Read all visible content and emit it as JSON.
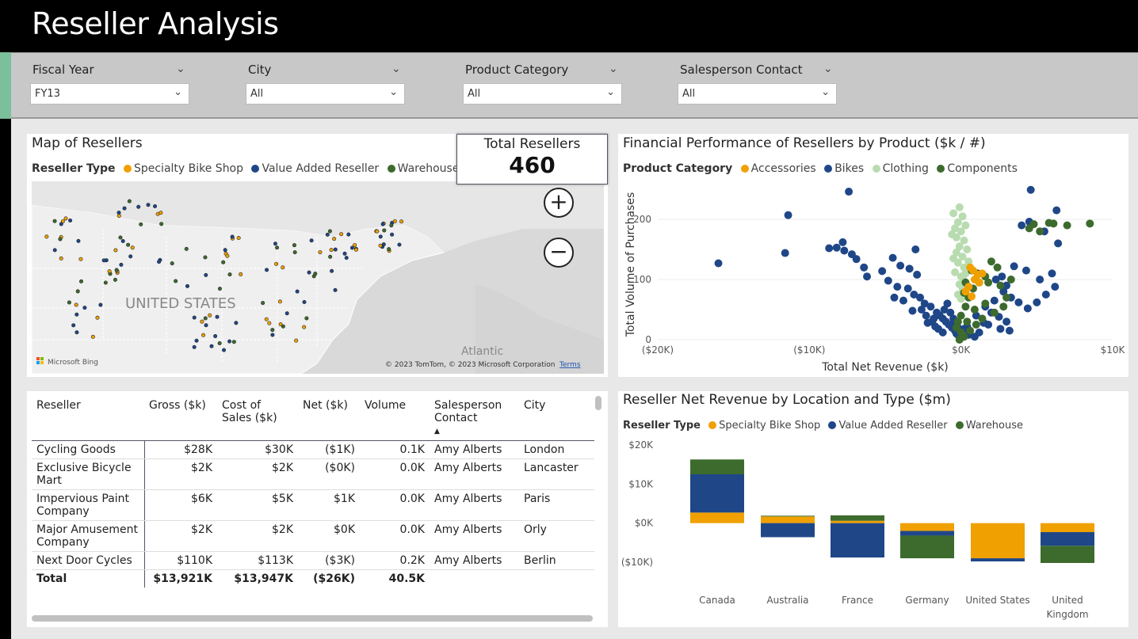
{
  "header": {
    "title": "Reseller Analysis"
  },
  "filters": [
    {
      "label": "Fiscal Year",
      "value": "FY13"
    },
    {
      "label": "City",
      "value": "All"
    },
    {
      "label": "Product Category",
      "value": "All"
    },
    {
      "label": "Salesperson Contact",
      "value": "All"
    }
  ],
  "map": {
    "title": "Map of Resellers",
    "legend_title": "Reseller Type",
    "legend": [
      {
        "name": "Specialty Bike Shop",
        "color": "#f0a000"
      },
      {
        "name": "Value Added Reseller",
        "color": "#1f4788"
      },
      {
        "name": "Warehouse",
        "color": "#3d6b2e"
      }
    ],
    "country_label": "UNITED STATES",
    "ocean_label": "Atlantic",
    "bing_label": "Microsoft Bing",
    "copyright": "© 2023 TomTom, © 2023 Microsoft Corporation",
    "terms": "Terms",
    "zoom_in": "+",
    "zoom_out": "−"
  },
  "card": {
    "label": "Total Resellers",
    "value": "460"
  },
  "scatter": {
    "title": "Financial Performance of Resellers by Product ($k / #)",
    "legend_title": "Product Category",
    "legend": [
      {
        "name": "Accessories",
        "color": "#f0a000"
      },
      {
        "name": "Bikes",
        "color": "#1f4788"
      },
      {
        "name": "Clothing",
        "color": "#b8dcb0"
      },
      {
        "name": "Components",
        "color": "#3d6b2e"
      }
    ]
  },
  "table": {
    "columns": [
      "Reseller",
      "Gross ($k)",
      "Cost of Sales ($k)",
      "Net ($k)",
      "Volume",
      "Salesperson Contact",
      "City"
    ],
    "rows": [
      [
        "Cycling Goods",
        "$28K",
        "$30K",
        "($1K)",
        "0.1K",
        "Amy Alberts",
        "London"
      ],
      [
        "Exclusive Bicycle Mart",
        "$2K",
        "$2K",
        "($0K)",
        "0.0K",
        "Amy Alberts",
        "Lancaster"
      ],
      [
        "Impervious Paint Company",
        "$6K",
        "$5K",
        "$1K",
        "0.0K",
        "Amy Alberts",
        "Paris"
      ],
      [
        "Major Amusement Company",
        "$2K",
        "$2K",
        "$0K",
        "0.0K",
        "Amy Alberts",
        "Orly"
      ],
      [
        "Next Door Cycles",
        "$110K",
        "$113K",
        "($3K)",
        "0.2K",
        "Amy Alberts",
        "Berlin"
      ]
    ],
    "total": [
      "Total",
      "$13,921K",
      "$13,947K",
      "($26K)",
      "40.5K",
      "",
      ""
    ]
  },
  "chart_data": [
    {
      "type": "scatter",
      "title": "Financial Performance of Resellers by Product ($k / #)",
      "xlabel": "Total Net Revenue ($k)",
      "ylabel": "Total Volume of Purchases",
      "xlim": [
        -20,
        10
      ],
      "ylim": [
        0,
        250
      ],
      "xticks": [
        "($20K)",
        "($10K)",
        "$0K",
        "$10K"
      ],
      "yticks": [
        "0",
        "100",
        "200"
      ],
      "legend_position": "top",
      "series": [
        {
          "name": "Bikes",
          "points": [
            [
              -16,
              127
            ],
            [
              -11.4,
              207
            ],
            [
              -11.6,
              144
            ],
            [
              -7.4,
              246
            ],
            [
              -8.2,
              153
            ],
            [
              -7.7,
              148
            ],
            [
              -7.2,
              142
            ],
            [
              -7.8,
              162
            ],
            [
              -6.9,
              134
            ],
            [
              -6.2,
              105
            ],
            [
              -5.2,
              114
            ],
            [
              -4.5,
              136
            ],
            [
              -4.0,
              123
            ],
            [
              -3.0,
              150
            ],
            [
              -3.4,
              118
            ],
            [
              -2.9,
              108
            ],
            [
              -8.7,
              152
            ],
            [
              -6.4,
              120
            ],
            [
              -4.8,
              98
            ],
            [
              -4.2,
              88
            ],
            [
              -3.5,
              85
            ],
            [
              -3.1,
              75
            ],
            [
              -2.7,
              70
            ],
            [
              -2.4,
              60
            ],
            [
              -2.0,
              55
            ],
            [
              -1.6,
              45
            ],
            [
              -1.4,
              40
            ],
            [
              -1.2,
              35
            ],
            [
              -1.0,
              30
            ],
            [
              -0.8,
              25
            ],
            [
              -0.6,
              20
            ],
            [
              -0.4,
              15
            ],
            [
              -0.3,
              10
            ],
            [
              -0.2,
              8
            ],
            [
              -2.3,
              40
            ],
            [
              -1.9,
              30
            ],
            [
              -1.7,
              22
            ],
            [
              -1.5,
              18
            ],
            [
              -1.2,
              12
            ],
            [
              -2.6,
              50
            ],
            [
              -3.8,
              65
            ],
            [
              -4.4,
              70
            ],
            [
              -3.2,
              48
            ],
            [
              -2.2,
              28
            ],
            [
              -1.8,
              35
            ],
            [
              -1.1,
              50
            ],
            [
              -0.9,
              60
            ],
            [
              -0.7,
              45
            ],
            [
              -0.5,
              35
            ],
            [
              -0.4,
              28
            ],
            [
              -0.2,
              20
            ],
            [
              -0.1,
              14
            ],
            [
              0.2,
              18
            ],
            [
              0.4,
              22
            ],
            [
              1.0,
              40
            ],
            [
              1.6,
              55
            ],
            [
              2.2,
              65
            ],
            [
              2.8,
              80
            ],
            [
              3.3,
              70
            ],
            [
              3.8,
              62
            ],
            [
              2.0,
              45
            ],
            [
              2.5,
              38
            ],
            [
              3.0,
              30
            ],
            [
              1.8,
              25
            ],
            [
              4.4,
              52
            ],
            [
              5.0,
              62
            ],
            [
              5.6,
              75
            ],
            [
              6.2,
              88
            ],
            [
              6.4,
              160
            ],
            [
              5.5,
              180
            ],
            [
              4.5,
              196
            ],
            [
              4.6,
              249
            ],
            [
              4.0,
              190
            ],
            [
              6.0,
              110
            ],
            [
              5.2,
              100
            ],
            [
              4.3,
              115
            ],
            [
              3.5,
              122
            ],
            [
              2.7,
              105
            ],
            [
              3.0,
              90
            ],
            [
              2.3,
              100
            ],
            [
              6.3,
              215
            ],
            [
              0.5,
              8
            ],
            [
              1.2,
              12
            ],
            [
              1.5,
              28
            ],
            [
              0.9,
              5
            ],
            [
              2.6,
              18
            ],
            [
              3.2,
              15
            ]
          ]
        },
        {
          "name": "Clothing",
          "points": [
            [
              -0.5,
              210
            ],
            [
              -0.2,
              195
            ],
            [
              0.1,
              205
            ],
            [
              -0.4,
              185
            ],
            [
              0,
              180
            ],
            [
              -0.3,
              170
            ],
            [
              0.2,
              165
            ],
            [
              -0.1,
              155
            ],
            [
              -0.3,
              145
            ],
            [
              0.1,
              138
            ],
            [
              -0.2,
              128
            ],
            [
              0.2,
              120
            ],
            [
              -0.4,
              112
            ],
            [
              0,
              105
            ],
            [
              0.2,
              98
            ],
            [
              -0.1,
              92
            ],
            [
              0.1,
              85
            ],
            [
              0.3,
              78
            ],
            [
              -0.2,
              75
            ],
            [
              0,
              68
            ],
            [
              0.4,
              150
            ],
            [
              -0.6,
              175
            ],
            [
              -0.1,
              220
            ],
            [
              0.3,
              190
            ],
            [
              0.5,
              130
            ],
            [
              -0.5,
              135
            ],
            [
              0.3,
              110
            ]
          ]
        },
        {
          "name": "Components",
          "points": [
            [
              2.0,
              130
            ],
            [
              2.4,
              120
            ],
            [
              1.6,
              105
            ],
            [
              1.2,
              95
            ],
            [
              0.8,
              85
            ],
            [
              0.5,
              70
            ],
            [
              0.3,
              55
            ],
            [
              0,
              40
            ],
            [
              -0.2,
              30
            ],
            [
              -0.3,
              20
            ],
            [
              0,
              12
            ],
            [
              0.2,
              5
            ],
            [
              -0.1,
              0
            ],
            [
              3.0,
              70
            ],
            [
              2.8,
              55
            ],
            [
              2.2,
              45
            ],
            [
              1.4,
              35
            ],
            [
              1.0,
              25
            ],
            [
              0.6,
              15
            ],
            [
              0.4,
              30
            ],
            [
              0.9,
              50
            ],
            [
              1.6,
              60
            ],
            [
              2.6,
              90
            ],
            [
              3.3,
              100
            ],
            [
              1.1,
              110
            ],
            [
              1.8,
              95
            ],
            [
              6.1,
              193
            ],
            [
              7.0,
              190
            ],
            [
              8.5,
              193
            ],
            [
              4.5,
              185
            ],
            [
              4.8,
              192
            ],
            [
              5.2,
              180
            ],
            [
              5.8,
              194
            ],
            [
              0.3,
              95
            ],
            [
              0.7,
              115
            ],
            [
              0.2,
              78
            ]
          ]
        },
        {
          "name": "Accessories",
          "points": [
            [
              0.6,
              120
            ],
            [
              0.8,
              115
            ],
            [
              1.1,
              108
            ],
            [
              0.9,
              100
            ],
            [
              1.2,
              95
            ],
            [
              0.5,
              88
            ],
            [
              0.3,
              80
            ],
            [
              0.7,
              72
            ],
            [
              1.4,
              110
            ]
          ]
        }
      ]
    },
    {
      "type": "bar",
      "stacked": true,
      "title": "Reseller Net Revenue by Location and Type ($m)",
      "legend_title": "Reseller Type",
      "legend_position": "top",
      "categories": [
        "Canada",
        "Australia",
        "France",
        "Germany",
        "United States",
        "United Kingdom"
      ],
      "yticks": [
        "$20K",
        "$10K",
        "$0K",
        "($10K)"
      ],
      "ylim": [
        -10,
        20
      ],
      "series": [
        {
          "name": "Specialty Bike Shop",
          "color": "#f0a000",
          "values": [
            2.7,
            1.7,
            0.6,
            -2.0,
            -9.0,
            -2.3
          ]
        },
        {
          "name": "Value Added Reseller",
          "color": "#1f4788",
          "values": [
            9.8,
            -3.6,
            -8.8,
            -1.2,
            -0.8,
            -3.5
          ]
        },
        {
          "name": "Warehouse",
          "color": "#3d6b2e",
          "values": [
            3.8,
            0.2,
            1.4,
            -5.8,
            0,
            -4.4
          ]
        }
      ]
    }
  ]
}
